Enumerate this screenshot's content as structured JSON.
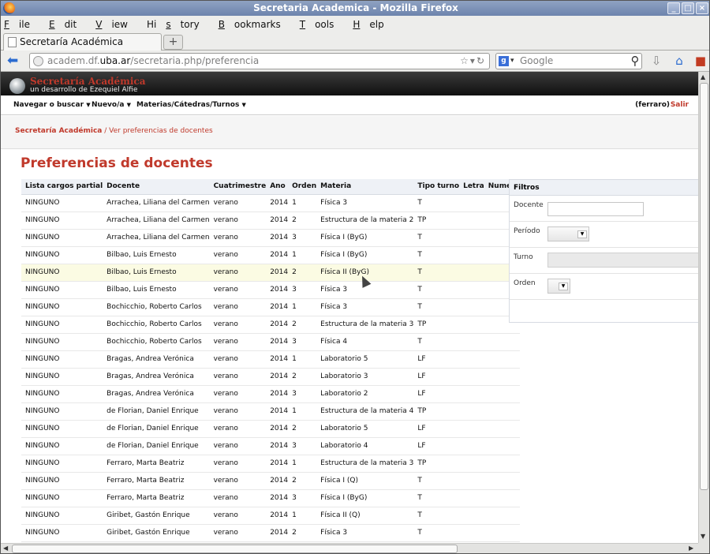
{
  "window": {
    "title": "Secretaria Academica - Mozilla Firefox"
  },
  "menu": {
    "items": [
      {
        "u": "F",
        "rest": "ile"
      },
      {
        "u": "E",
        "rest": "dit"
      },
      {
        "u": "V",
        "rest": "iew"
      },
      {
        "pre": "Hi",
        "u": "s",
        "rest": "tory"
      },
      {
        "u": "B",
        "rest": "ookmarks"
      },
      {
        "u": "T",
        "rest": "ools"
      },
      {
        "u": "H",
        "rest": "elp"
      }
    ]
  },
  "tab": {
    "label": "Secretaría Académica",
    "new_tab_symbol": "+"
  },
  "nav": {
    "url_prefix": "academ.df.",
    "url_domain": "uba.ar",
    "url_path": "/secretaria.php/preferencia",
    "search_placeholder": "Google"
  },
  "app": {
    "title": "Secretaría Académica",
    "subtitle": "un desarrollo de Ezequiel Alfie",
    "menu": [
      "Navegar o buscar",
      "Nuevo/a",
      "Materias/Cátedras/Turnos"
    ],
    "user": "(ferraro)",
    "logout": "Salir",
    "breadcrumb_root": "Secretaría Académica",
    "breadcrumb_sep": " / ",
    "breadcrumb_current": "Ver preferencias de docentes",
    "page_title": "Preferencias de docentes"
  },
  "table": {
    "headers": [
      "Lista cargos partial",
      "Docente",
      "Cuatrimestre",
      "Ano",
      "Orden",
      "Materia",
      "Tipo turno",
      "Letra",
      "Numero"
    ],
    "rows": [
      [
        "NINGUNO",
        "Arrachea, Liliana del Carmen",
        "verano",
        "2014",
        "1",
        "Física 3",
        "T",
        "",
        ""
      ],
      [
        "NINGUNO",
        "Arrachea, Liliana del Carmen",
        "verano",
        "2014",
        "2",
        "Estructura de la materia 2",
        "TP",
        "",
        ""
      ],
      [
        "NINGUNO",
        "Arrachea, Liliana del Carmen",
        "verano",
        "2014",
        "3",
        "Física I (ByG)",
        "T",
        "",
        ""
      ],
      [
        "NINGUNO",
        "Bilbao, Luis Ernesto",
        "verano",
        "2014",
        "1",
        "Física I (ByG)",
        "T",
        "",
        ""
      ],
      [
        "NINGUNO",
        "Bilbao, Luis Ernesto",
        "verano",
        "2014",
        "2",
        "Física II (ByG)",
        "T",
        "",
        ""
      ],
      [
        "NINGUNO",
        "Bilbao, Luis Ernesto",
        "verano",
        "2014",
        "3",
        "Física 3",
        "T",
        "",
        ""
      ],
      [
        "NINGUNO",
        "Bochicchio, Roberto Carlos",
        "verano",
        "2014",
        "1",
        "Física 3",
        "T",
        "",
        ""
      ],
      [
        "NINGUNO",
        "Bochicchio, Roberto Carlos",
        "verano",
        "2014",
        "2",
        "Estructura de la materia 3",
        "TP",
        "",
        ""
      ],
      [
        "NINGUNO",
        "Bochicchio, Roberto Carlos",
        "verano",
        "2014",
        "3",
        "Física 4",
        "T",
        "",
        ""
      ],
      [
        "NINGUNO",
        "Bragas, Andrea Verónica",
        "verano",
        "2014",
        "1",
        "Laboratorio 5",
        "LF",
        "",
        ""
      ],
      [
        "NINGUNO",
        "Bragas, Andrea Verónica",
        "verano",
        "2014",
        "2",
        "Laboratorio 3",
        "LF",
        "",
        ""
      ],
      [
        "NINGUNO",
        "Bragas, Andrea Verónica",
        "verano",
        "2014",
        "3",
        "Laboratorio 2",
        "LF",
        "",
        ""
      ],
      [
        "NINGUNO",
        "de Florian, Daniel Enrique",
        "verano",
        "2014",
        "1",
        "Estructura de la materia 4",
        "TP",
        "",
        ""
      ],
      [
        "NINGUNO",
        "de Florian, Daniel Enrique",
        "verano",
        "2014",
        "2",
        "Laboratorio 5",
        "LF",
        "",
        ""
      ],
      [
        "NINGUNO",
        "de Florian, Daniel Enrique",
        "verano",
        "2014",
        "3",
        "Laboratorio 4",
        "LF",
        "",
        ""
      ],
      [
        "NINGUNO",
        "Ferraro, Marta Beatriz",
        "verano",
        "2014",
        "1",
        "Estructura de la materia 3",
        "TP",
        "",
        ""
      ],
      [
        "NINGUNO",
        "Ferraro, Marta Beatriz",
        "verano",
        "2014",
        "2",
        "Física I (Q)",
        "T",
        "",
        ""
      ],
      [
        "NINGUNO",
        "Ferraro, Marta Beatriz",
        "verano",
        "2014",
        "3",
        "Física I (ByG)",
        "T",
        "",
        ""
      ],
      [
        "NINGUNO",
        "Giribet, Gastón Enrique",
        "verano",
        "2014",
        "1",
        "Física II (Q)",
        "T",
        "",
        ""
      ],
      [
        "NINGUNO",
        "Giribet, Gastón Enrique",
        "verano",
        "2014",
        "2",
        "Física 3",
        "T",
        "",
        ""
      ]
    ]
  },
  "filters": {
    "title": "Filtros",
    "docente_label": "Docente",
    "periodo_label": "Período",
    "turno_label": "Turno",
    "orden_label": "Orden"
  },
  "colors": {
    "accent": "#c0392b",
    "row_highlight": "#fbfbe3",
    "header_bg": "#eef1f6"
  }
}
